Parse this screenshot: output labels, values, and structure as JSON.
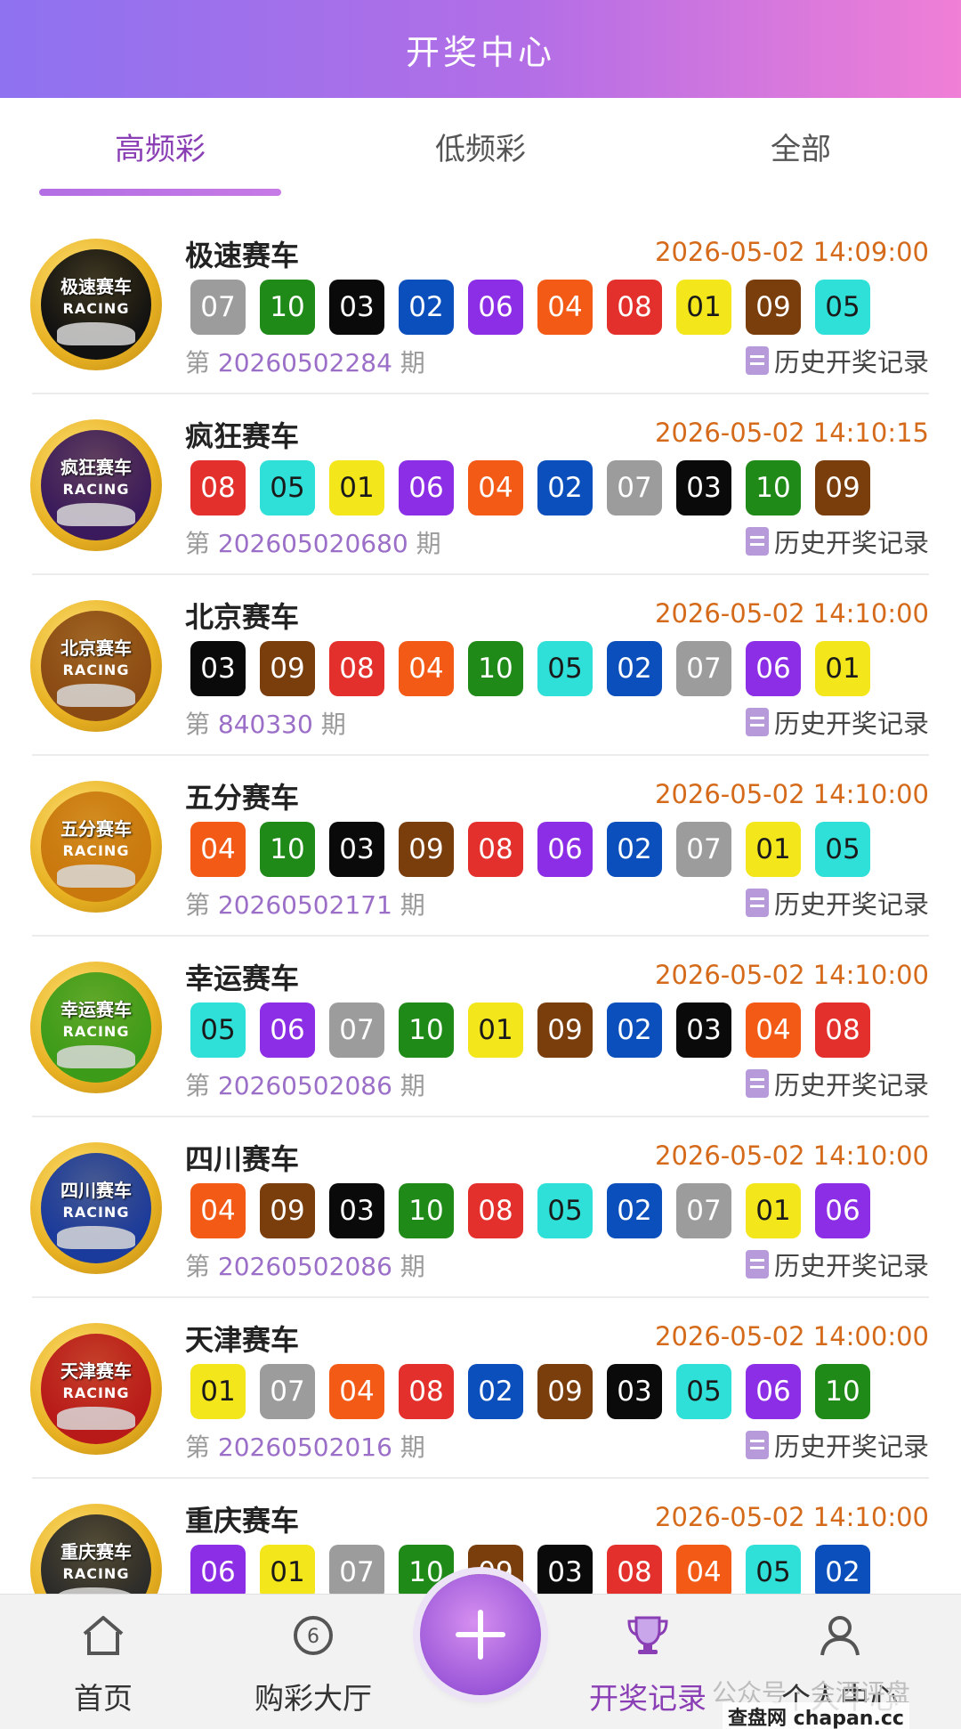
{
  "header": {
    "title": "开奖中心"
  },
  "tabs": [
    {
      "label": "高频彩",
      "active": true
    },
    {
      "label": "低频彩",
      "active": false
    },
    {
      "label": "全部",
      "active": false
    }
  ],
  "ball_colors": {
    "01": "#f3e61a",
    "02": "#0b4fbd",
    "03": "#0a0a0a",
    "04": "#f35a16",
    "05": "#2fe0d8",
    "06": "#8b2ee6",
    "07": "#9c9c9c",
    "08": "#e3302c",
    "09": "#7a3d0c",
    "10": "#1f8a18"
  },
  "issue_prefix": "第",
  "issue_suffix": "期",
  "history_label": "历史开奖记录",
  "games": [
    {
      "name": "极速赛车",
      "time": "2026-05-02 14:09:00",
      "issue": "20260502284",
      "badge_name": "极速赛车",
      "badge_sub": "RACING",
      "badge_color": "#111111",
      "balls": [
        "07",
        "10",
        "03",
        "02",
        "06",
        "04",
        "08",
        "01",
        "09",
        "05"
      ]
    },
    {
      "name": "疯狂赛车",
      "time": "2026-05-02 14:10:15",
      "issue": "202605020680",
      "badge_name": "疯狂赛车",
      "badge_sub": "RACING",
      "badge_color": "#3a1a5c",
      "balls": [
        "08",
        "05",
        "01",
        "06",
        "04",
        "02",
        "07",
        "03",
        "10",
        "09"
      ]
    },
    {
      "name": "北京赛车",
      "time": "2026-05-02 14:10:00",
      "issue": "840330",
      "badge_name": "北京赛车",
      "badge_sub": "RACING",
      "badge_color": "#8a4a14",
      "balls": [
        "03",
        "09",
        "08",
        "04",
        "10",
        "05",
        "02",
        "07",
        "06",
        "01"
      ]
    },
    {
      "name": "五分赛车",
      "time": "2026-05-02 14:10:00",
      "issue": "20260502171",
      "badge_name": "五分赛车",
      "badge_sub": "RACING",
      "badge_color": "#c9780e",
      "balls": [
        "04",
        "10",
        "03",
        "09",
        "08",
        "06",
        "02",
        "07",
        "01",
        "05"
      ]
    },
    {
      "name": "幸运赛车",
      "time": "2026-05-02 14:10:00",
      "issue": "20260502086",
      "badge_name": "幸运赛车",
      "badge_sub": "RACING",
      "badge_color": "#3c9c1a",
      "balls": [
        "05",
        "06",
        "07",
        "10",
        "01",
        "09",
        "02",
        "03",
        "04",
        "08"
      ]
    },
    {
      "name": "四川赛车",
      "time": "2026-05-02 14:10:00",
      "issue": "20260502086",
      "badge_name": "四川赛车",
      "badge_sub": "RACING",
      "badge_color": "#1a3a9c",
      "balls": [
        "04",
        "09",
        "03",
        "10",
        "08",
        "05",
        "02",
        "07",
        "01",
        "06"
      ]
    },
    {
      "name": "天津赛车",
      "time": "2026-05-02 14:00:00",
      "issue": "20260502016",
      "badge_name": "天津赛车",
      "badge_sub": "RACING",
      "badge_color": "#b81a1a",
      "balls": [
        "01",
        "07",
        "04",
        "08",
        "02",
        "09",
        "03",
        "05",
        "06",
        "10"
      ]
    },
    {
      "name": "重庆赛车",
      "time": "2026-05-02 14:10:00",
      "issue": "",
      "badge_name": "重庆赛车",
      "badge_sub": "RACING",
      "badge_color": "#2a2a2a",
      "balls": [
        "06",
        "01",
        "07",
        "10",
        "09",
        "03",
        "08",
        "04",
        "05",
        "02"
      ]
    }
  ],
  "bottom_nav": [
    {
      "label": "首页",
      "icon": "home-icon",
      "active": false
    },
    {
      "label": "购彩大厅",
      "icon": "lottery-ball-icon",
      "active": false
    },
    {
      "label": "开奖记录",
      "icon": "trophy-icon",
      "active": true
    },
    {
      "label": "个人中心",
      "icon": "user-icon",
      "active": false
    }
  ],
  "fab": {
    "icon": "plus-icon"
  },
  "watermark": {
    "text": "公众号 · 会酒评盘",
    "logo": "查盘网 chapan.cc"
  }
}
